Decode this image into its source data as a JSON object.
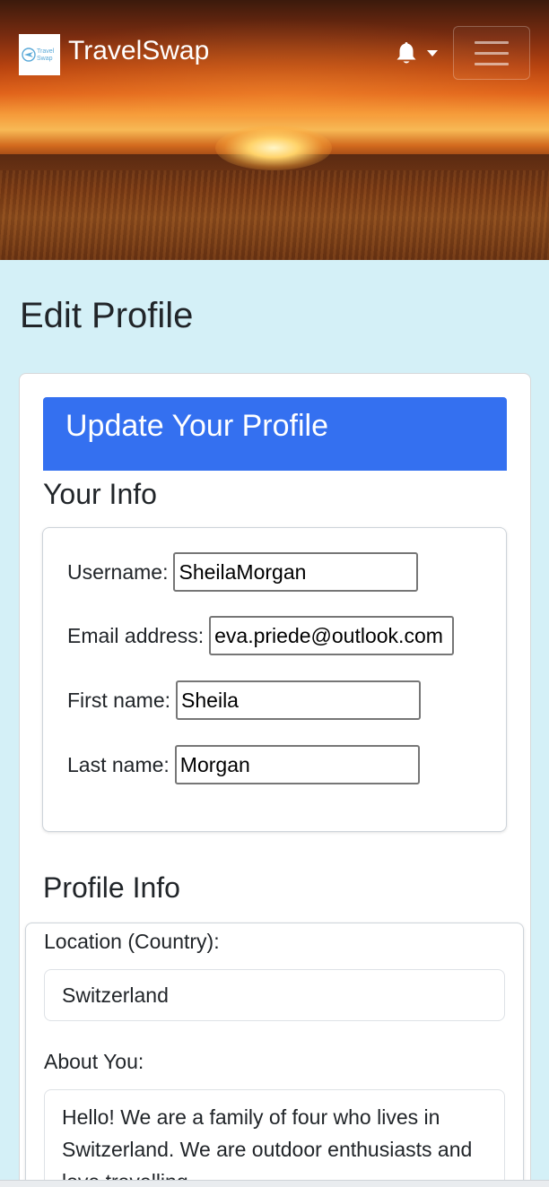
{
  "navbar": {
    "brand": "TravelSwap",
    "logo_text_line1": "Travel",
    "logo_text_line2": "Swap",
    "notifications_icon": "bell-icon",
    "menu_icon": "hamburger-icon"
  },
  "page": {
    "title": "Edit Profile"
  },
  "card": {
    "header": "Update Your Profile"
  },
  "your_info": {
    "heading": "Your Info",
    "username_label": "Username:",
    "username_value": "SheilaMorgan",
    "email_label": "Email address:",
    "email_value": "eva.priede@outlook.com",
    "first_name_label": "First name:",
    "first_name_value": "Sheila",
    "last_name_label": "Last name:",
    "last_name_value": "Morgan"
  },
  "profile_info": {
    "heading": "Profile Info",
    "location_label": "Location (Country):",
    "location_value": "Switzerland",
    "about_label": "About You:",
    "about_value": "Hello! We are a family of four who lives in Switzerland. We are outdoor enthusiasts and love travelling."
  },
  "colors": {
    "page_background": "#d4f0f7",
    "card_header": "#3470f0",
    "text": "#212529"
  }
}
